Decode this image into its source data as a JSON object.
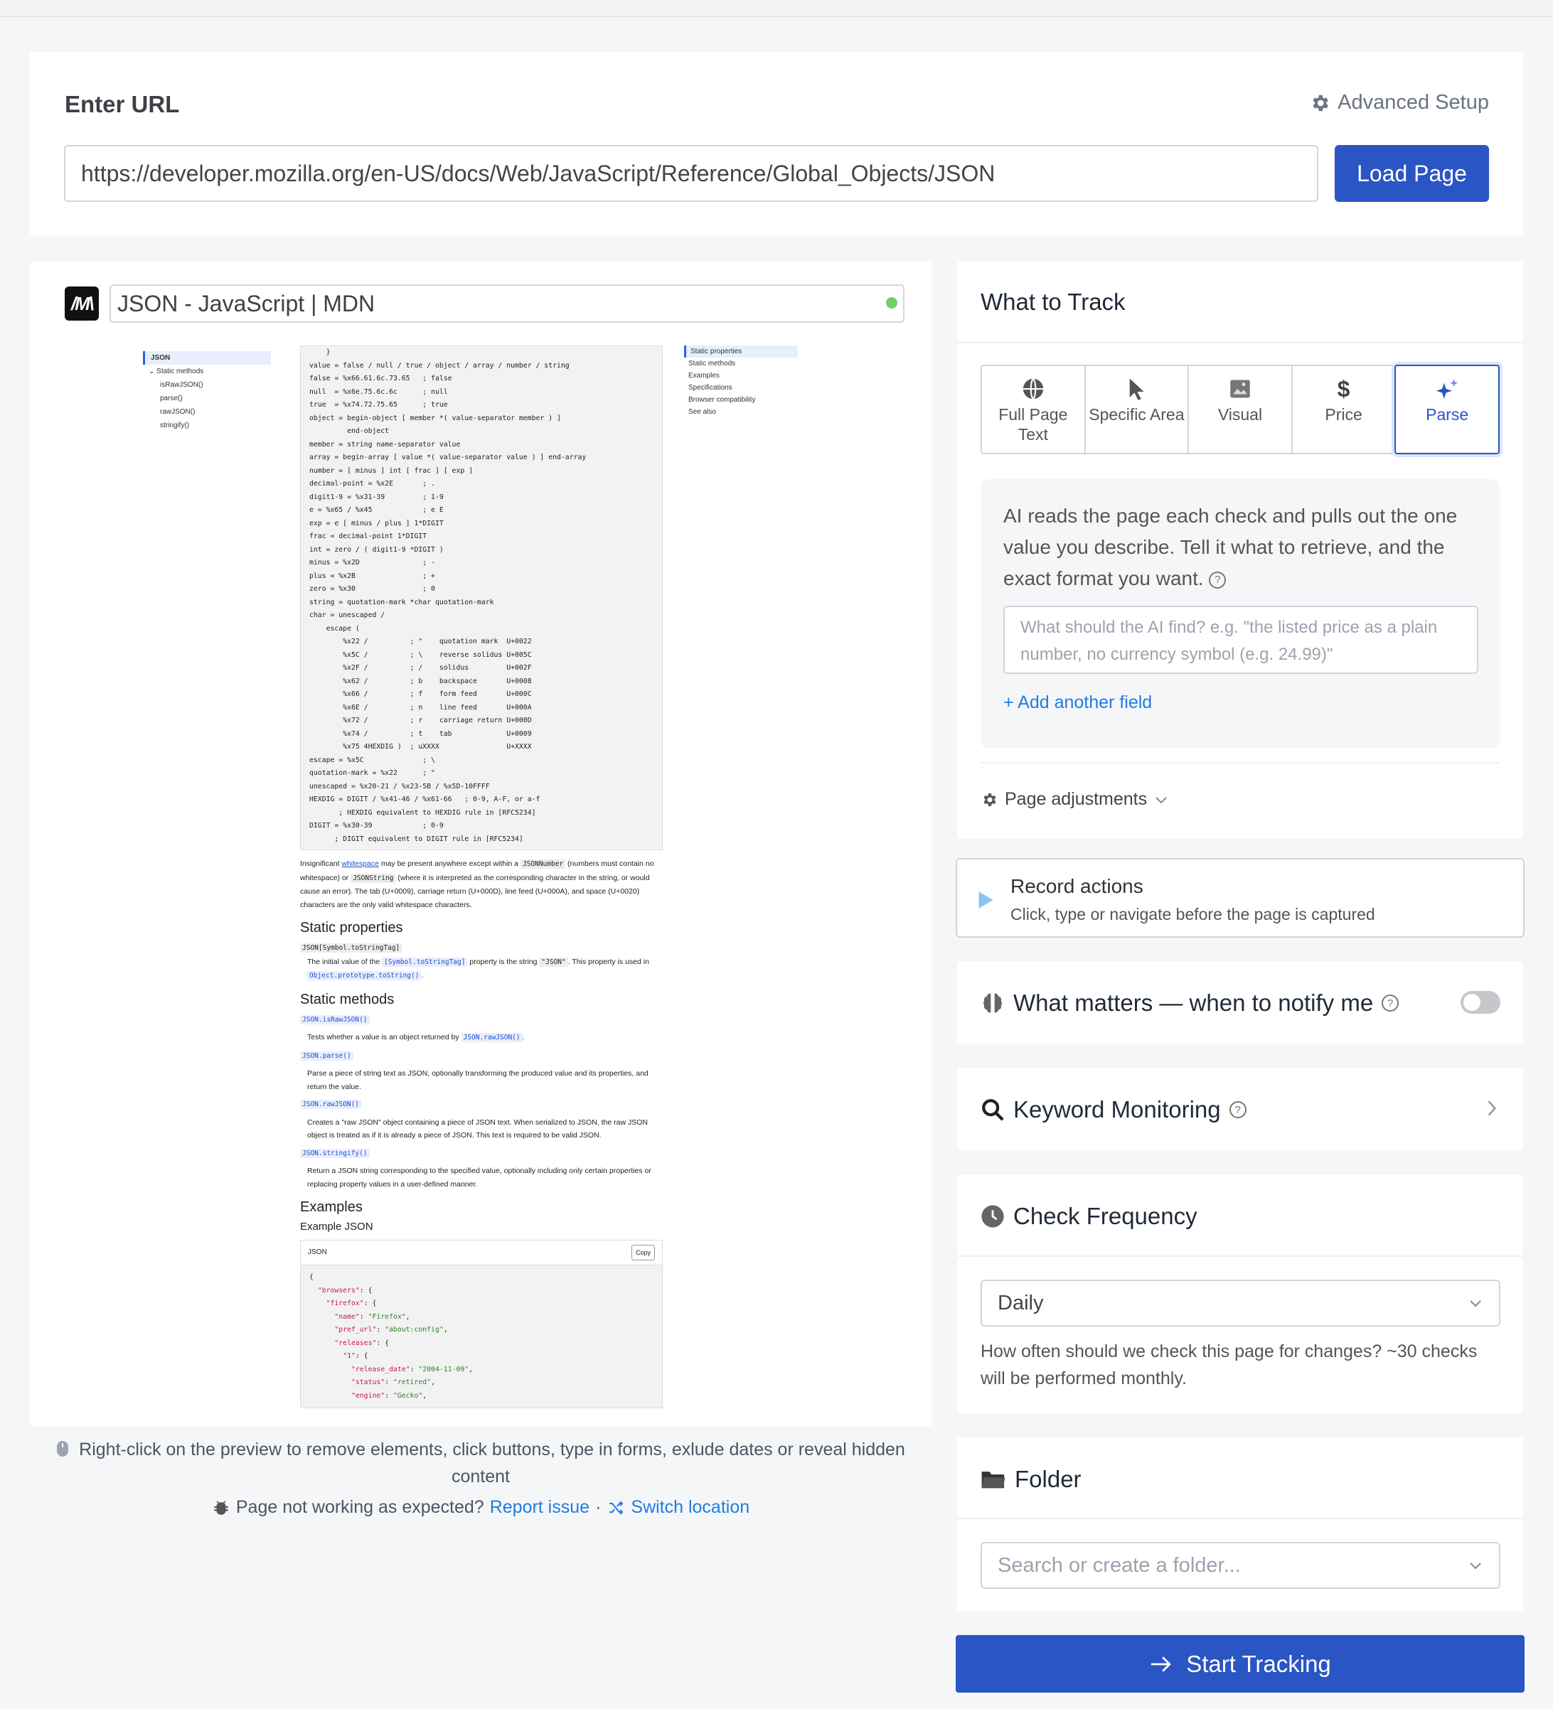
{
  "url_section": {
    "heading": "Enter URL",
    "advanced_setup": "Advanced Setup",
    "url_value": "https://developer.mozilla.org/en-US/docs/Web/JavaScript/Reference/Global_Objects/JSON",
    "load_button": "Load Page"
  },
  "preview": {
    "logo_text": "M",
    "page_title": "JSON - JavaScript | MDN",
    "status_color": "#6fd16a",
    "doc": {
      "sidebar": [
        "JSON",
        "⌄ Static methods",
        "isRawJSON()",
        "parse()",
        "rawJSON()",
        "stringify()"
      ],
      "right_nav": [
        "Static properties",
        "Static methods",
        "Examples",
        "Specifications",
        "Browser compatibility",
        "See also"
      ],
      "grammar": "    }\nvalue = false / null / true / object / array / number / string\nfalse = %x66.61.6c.73.65   ; false\nnull  = %x6e.75.6c.6c      ; null\ntrue  = %x74.72.75.65      ; true\nobject = begin-object [ member *( value-separator member ) ]\n         end-object\nmember = string name-separator value\narray = begin-array [ value *( value-separator value ) ] end-array\nnumber = [ minus ] int [ frac ] [ exp ]\ndecimal-point = %x2E       ; .\ndigit1-9 = %x31-39         ; 1-9\ne = %x65 / %x45            ; e E\nexp = e [ minus / plus ] 1*DIGIT\nfrac = decimal-point 1*DIGIT\nint = zero / ( digit1-9 *DIGIT )\nminus = %x2D               ; -\nplus = %x2B                ; +\nzero = %x30                ; 0\nstring = quotation-mark *char quotation-mark\nchar = unescaped /\n    escape (\n        %x22 /          ; \"    quotation mark  U+0022\n        %x5C /          ; \\    reverse solidus U+005C\n        %x2F /          ; /    solidus         U+002F\n        %x62 /          ; b    backspace       U+0008\n        %x66 /          ; f    form feed       U+000C\n        %x6E /          ; n    line feed       U+000A\n        %x72 /          ; r    carriage return U+000D\n        %x74 /          ; t    tab             U+0009\n        %x75 4HEXDIG )  ; uXXXX                U+XXXX\nescape = %x5C              ; \\\nquotation-mark = %x22      ; \"\nunescaped = %x20-21 / %x23-5B / %x5D-10FFFF\nHEXDIG = DIGIT / %x41-46 / %x61-66   ; 0-9, A-F, or a-f\n       ; HEXDIG equivalent to HEXDIG rule in [RFC5234]\nDIGIT = %x30-39            ; 0-9\n      ; DIGIT equivalent to DIGIT rule in [RFC5234]",
      "whitespace_para_a": "Insignificant ",
      "whitespace_link": "whitespace",
      "whitespace_para_b": " may be present anywhere except within a ",
      "whitespace_code1": "JSONNumber",
      "whitespace_para_c": " (numbers must contain no whitespace) or ",
      "whitespace_code2": "JSONString",
      "whitespace_para_d": " (where it is interpreted as the corresponding character in the string, or would cause an error). The tab (U+0009), carriage return (U+000D), line feed (U+000A), and space (U+0020) characters are the only valid whitespace characters.",
      "h_static_props": "Static properties",
      "prop_name": "JSON[Symbol.toStringTag]",
      "prop_desc_a": "The initial value of the ",
      "prop_desc_link": "[Symbol.toStringTag]",
      "prop_desc_b": " property is the string ",
      "prop_desc_code": "\"JSON\"",
      "prop_desc_c": ". This property is used in ",
      "prop_desc_link2": "Object.prototype.toString()",
      "prop_desc_d": ".",
      "h_static_methods": "Static methods",
      "methods": [
        {
          "name": "JSON.isRawJSON()",
          "desc_a": "Tests whether a value is an object returned by ",
          "desc_link": "JSON.rawJSON()",
          "desc_b": "."
        },
        {
          "name": "JSON.parse()",
          "desc_a": "Parse a piece of string text as JSON, optionally transforming the produced value and its properties, and return the value.",
          "desc_link": "",
          "desc_b": ""
        },
        {
          "name": "JSON.rawJSON()",
          "desc_a": "Creates a \"raw JSON\" object containing a piece of JSON text. When serialized to JSON, the raw JSON object is treated as if it is already a piece of JSON. This text is required to be valid JSON.",
          "desc_link": "",
          "desc_b": ""
        },
        {
          "name": "JSON.stringify()",
          "desc_a": "Return a JSON string corresponding to the specified value, optionally including only certain properties or replacing property values in a user-defined manner.",
          "desc_link": "",
          "desc_b": ""
        }
      ],
      "h_examples": "Examples",
      "h_example_json": "Example JSON",
      "json_label": "JSON",
      "copy_label": "Copy",
      "json_lines": [
        [
          "{",
          "",
          ""
        ],
        [
          "  ",
          "\"browsers\"",
          ": {"
        ],
        [
          "    ",
          "\"firefox\"",
          ": {"
        ],
        [
          "      ",
          "\"name\"",
          ": |\"Firefox\"|,"
        ],
        [
          "      ",
          "\"pref_url\"",
          ": |\"about:config\"|,"
        ],
        [
          "      ",
          "\"releases\"",
          ": {"
        ],
        [
          "        ",
          "\"1\"",
          ": {"
        ],
        [
          "          ",
          "\"release_date\"",
          ": |\"2004-11-09\"|,"
        ],
        [
          "          ",
          "\"status\"",
          ": |\"retired\"|,"
        ],
        [
          "          ",
          "\"engine\"",
          ": |\"Gecko\"|,"
        ]
      ]
    }
  },
  "preview_hint": "Right-click on the preview to remove elements, click buttons, type in forms, exlude dates or reveal hidden content",
  "issue": {
    "text": "Page not working as expected?",
    "report_link": "Report issue",
    "separator": "·",
    "switch_link": "Switch location"
  },
  "what_to_track": {
    "heading": "What to Track",
    "tabs": [
      {
        "label": "Full Page Text",
        "icon": "globe-icon"
      },
      {
        "label": "Specific Area",
        "icon": "cursor-icon"
      },
      {
        "label": "Visual",
        "icon": "image-icon"
      },
      {
        "label": "Price",
        "icon": "dollar-icon"
      },
      {
        "label": "Parse",
        "icon": "sparkles-icon",
        "selected": true
      }
    ],
    "parse_description": "AI reads the page each check and pulls out the one value you describe. Tell it what to retrieve, and the exact format you want.",
    "parse_placeholder": "What should the AI find? e.g. \"the listed price as a plain number, no currency symbol (e.g. 24.99)\"",
    "add_field": "+ Add another field",
    "page_adjustments": "Page adjustments"
  },
  "record_actions": {
    "title": "Record actions",
    "subtitle": "Click, type or navigate before the page is captured"
  },
  "what_matters": {
    "title": "What matters — when to notify me",
    "enabled": false
  },
  "keyword_monitoring": {
    "title": "Keyword Monitoring"
  },
  "check_frequency": {
    "title": "Check Frequency",
    "selected": "Daily",
    "help": "How often should we check this page for changes? ~30 checks will be performed monthly."
  },
  "folder": {
    "title": "Folder",
    "placeholder": "Search or create a folder..."
  },
  "start_button": "Start Tracking",
  "colors": {
    "primary": "#2a55c4",
    "link": "#1e7de0"
  }
}
